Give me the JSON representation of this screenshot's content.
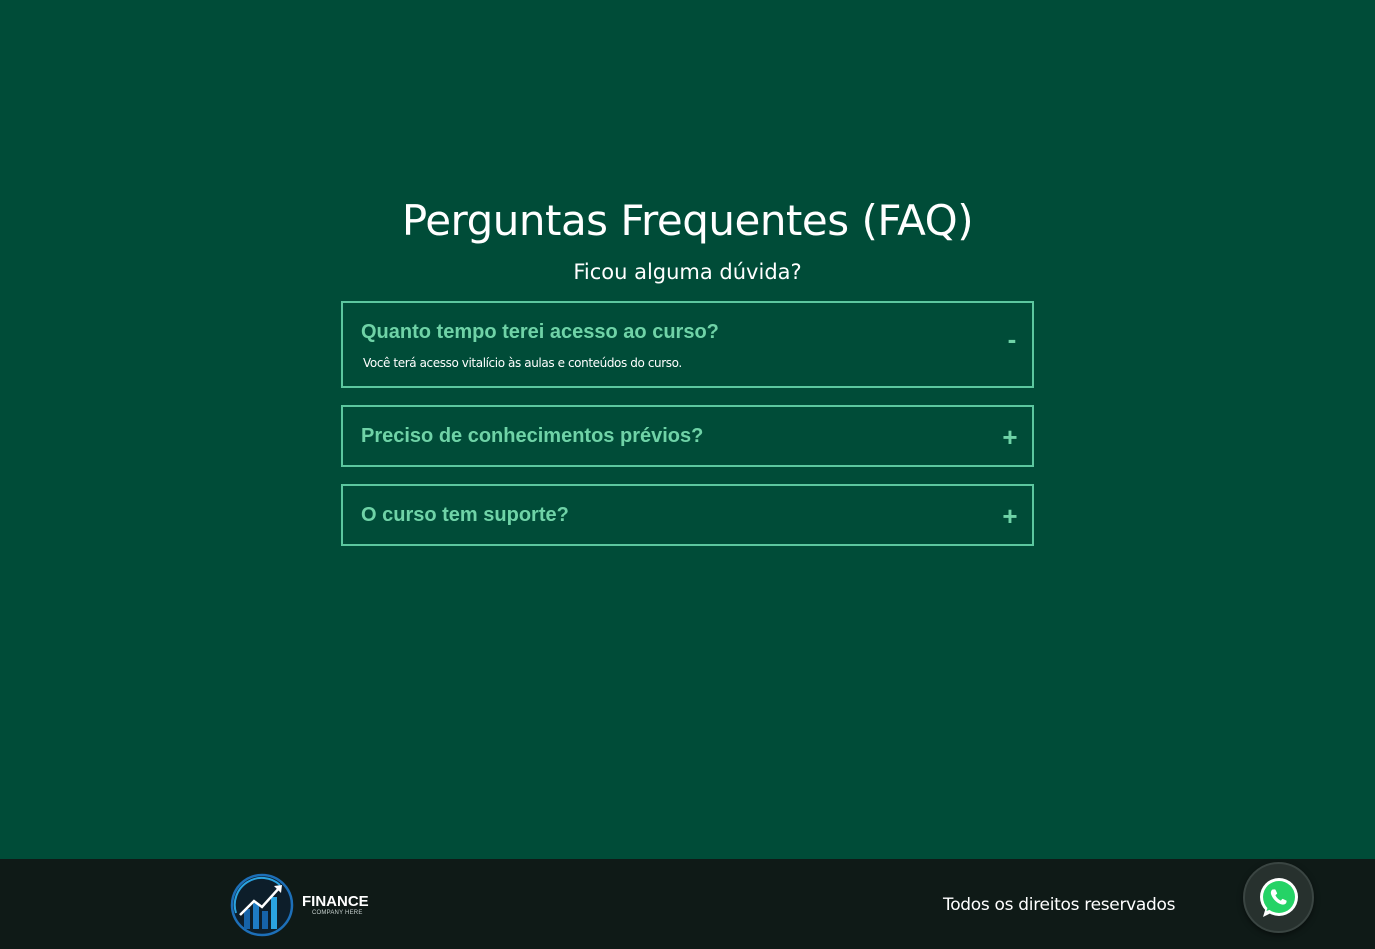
{
  "faq": {
    "title": "Perguntas Frequentes (FAQ)",
    "subtitle": "Ficou alguma dúvida?",
    "items": [
      {
        "question": "Quanto tempo terei acesso ao curso?",
        "answer": "Você terá acesso vitalício às aulas e conteúdos do curso.",
        "toggle": "-",
        "expanded": true
      },
      {
        "question": "Preciso de conhecimentos prévios?",
        "toggle": "+",
        "expanded": false
      },
      {
        "question": "O curso tem suporte?",
        "toggle": "+",
        "expanded": false
      }
    ]
  },
  "footer": {
    "logo_name": "FINANCE",
    "logo_tagline": "COMPANY HERE",
    "copyright": "Todos os direitos reservados",
    "whatsapp_icon": "whatsapp-icon"
  },
  "colors": {
    "background": "#004c38",
    "accent": "#6fd3a7",
    "border": "#5cc79f",
    "footer_background": "#0f1a17",
    "whatsapp_green": "#25d366"
  }
}
